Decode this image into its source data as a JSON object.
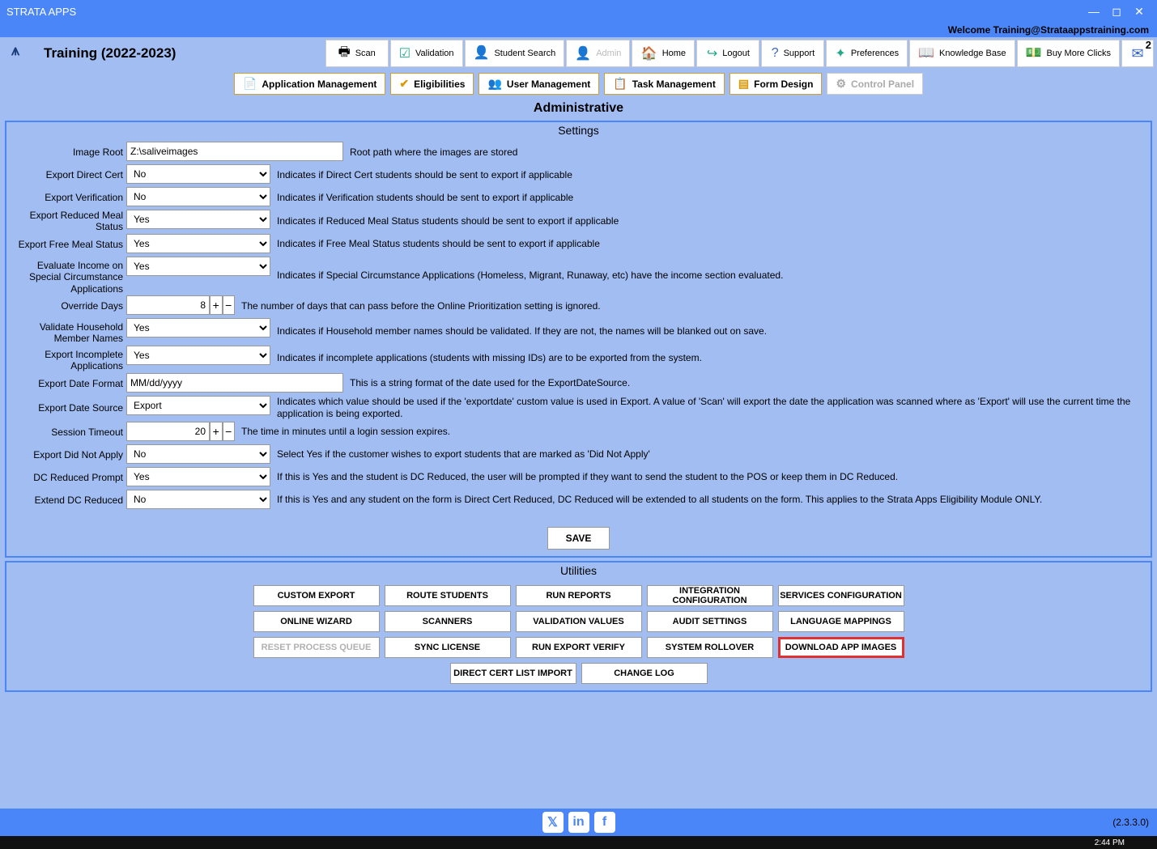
{
  "app_title": "STRATA APPS",
  "welcome": "Welcome Training@Strataappstraining.com",
  "training_label": "Training (2022-2023)",
  "nav": {
    "scan": "Scan",
    "validation": "Validation",
    "student_search": "Student Search",
    "admin": "Admin",
    "home": "Home",
    "logout": "Logout",
    "support": "Support",
    "preferences": "Preferences",
    "knowledge_base": "Knowledge Base",
    "buy_more": "Buy More Clicks",
    "mail_count": "2"
  },
  "subnav": {
    "app_mgmt": "Application Management",
    "eligibilities": "Eligibilities",
    "user_mgmt": "User Management",
    "task_mgmt": "Task Management",
    "form_design": "Form Design",
    "control_panel": "Control Panel"
  },
  "page_heading": "Administrative",
  "settings_title": "Settings",
  "settings": [
    {
      "label": "Image Root",
      "type": "text",
      "value": "Z:\\saliveimages",
      "desc": "Root path where the images are stored"
    },
    {
      "label": "Export Direct Cert",
      "type": "select",
      "value": "No",
      "desc": "Indicates if Direct Cert students should be sent to export if applicable"
    },
    {
      "label": "Export Verification",
      "type": "select",
      "value": "No",
      "desc": "Indicates if Verification students should be sent to export if applicable"
    },
    {
      "label": "Export Reduced Meal Status",
      "type": "select",
      "value": "Yes",
      "desc": "Indicates if Reduced Meal Status students should be sent to export if applicable"
    },
    {
      "label": "Export Free Meal Status",
      "type": "select",
      "value": "Yes",
      "desc": "Indicates if Free Meal Status students should be sent to export if applicable"
    },
    {
      "label": "Evaluate Income on Special Circumstance Applications",
      "type": "select",
      "value": "Yes",
      "desc": "Indicates if Special Circumstance Applications (Homeless, Migrant, Runaway, etc) have the income section evaluated."
    },
    {
      "label": "Override Days",
      "type": "number",
      "value": "8",
      "desc": "The number of days that can pass before the Online Prioritization setting is ignored."
    },
    {
      "label": "Validate Household Member Names",
      "type": "select",
      "value": "Yes",
      "desc": "Indicates if Household member names should be validated. If they are not, the names will be blanked out on save."
    },
    {
      "label": "Export Incomplete Applications",
      "type": "select",
      "value": "Yes",
      "desc": "Indicates if incomplete applications (students with missing IDs) are to be exported from the system."
    },
    {
      "label": "Export Date Format",
      "type": "text",
      "value": "MM/dd/yyyy",
      "desc": "This is a string format of the date used for the ExportDateSource."
    },
    {
      "label": "Export Date Source",
      "type": "select",
      "value": "Export",
      "desc": "Indicates which value should be used if the 'exportdate' custom value is used in Export. A value of 'Scan' will export the date the application was scanned where as 'Export' will use the current time the application is being exported."
    },
    {
      "label": "Session Timeout",
      "type": "number",
      "value": "20",
      "desc": "The time in minutes until a login session expires."
    },
    {
      "label": "Export Did Not Apply",
      "type": "select",
      "value": "No",
      "desc": "Select Yes if the customer wishes to export students that are marked as 'Did Not Apply'"
    },
    {
      "label": "DC Reduced Prompt",
      "type": "select",
      "value": "Yes",
      "desc": "If this is Yes and the student is DC Reduced, the user will be prompted if they want to send the student to the POS or keep them in DC Reduced."
    },
    {
      "label": "Extend DC Reduced",
      "type": "select",
      "value": "No",
      "desc": "If this is Yes and any student on the form is Direct Cert Reduced, DC Reduced will be extended to all students on the form. This applies to the Strata Apps Eligibility Module ONLY."
    }
  ],
  "save_label": "SAVE",
  "utilities_title": "Utilities",
  "utilities": [
    {
      "label": "CUSTOM EXPORT"
    },
    {
      "label": "ROUTE STUDENTS"
    },
    {
      "label": "RUN REPORTS"
    },
    {
      "label": "INTEGRATION CONFIGURATION"
    },
    {
      "label": "SERVICES CONFIGURATION"
    },
    {
      "label": "ONLINE WIZARD"
    },
    {
      "label": "SCANNERS"
    },
    {
      "label": "VALIDATION VALUES"
    },
    {
      "label": "AUDIT SETTINGS"
    },
    {
      "label": "LANGUAGE MAPPINGS"
    },
    {
      "label": "RESET PROCESS QUEUE",
      "disabled": true
    },
    {
      "label": "SYNC LICENSE"
    },
    {
      "label": "RUN EXPORT VERIFY"
    },
    {
      "label": "SYSTEM ROLLOVER"
    },
    {
      "label": "DOWNLOAD APP IMAGES",
      "highlight": true
    },
    {
      "label": "DIRECT CERT LIST IMPORT"
    },
    {
      "label": "CHANGE LOG"
    }
  ],
  "version": "(2.3.3.0)",
  "taskbar_time": "2:44 PM"
}
